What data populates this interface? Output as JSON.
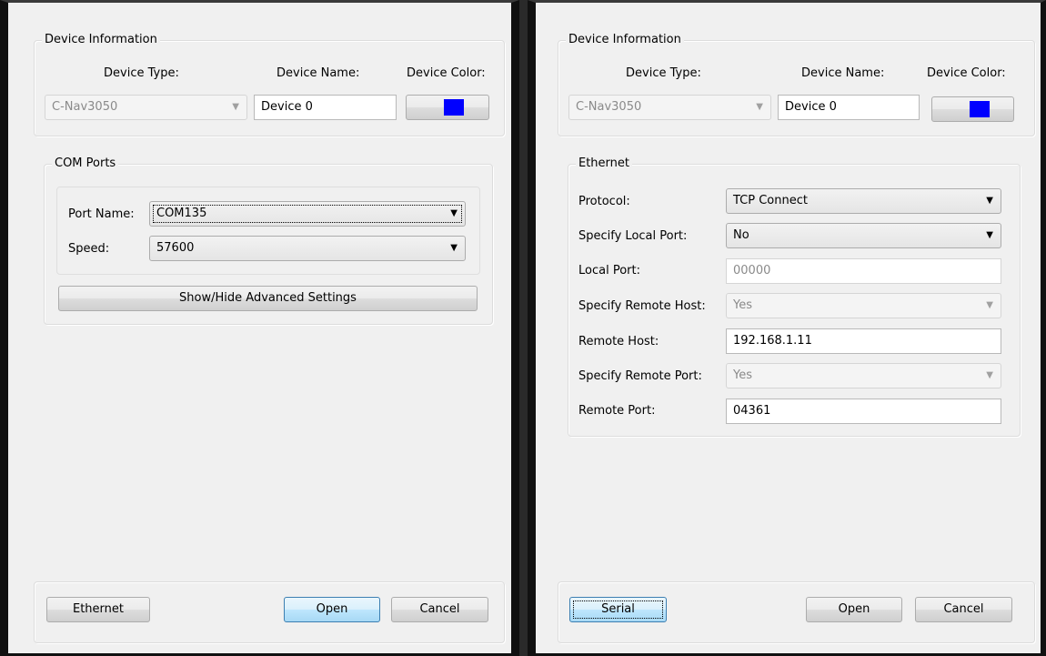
{
  "left_dialog": {
    "device_info": {
      "title": "Device Information",
      "type_label": "Device Type:",
      "name_label": "Device Name:",
      "color_label": "Device Color:",
      "type_value": "C-Nav3050",
      "name_value": "Device 0",
      "color": "#0000ff"
    },
    "com_ports": {
      "title": "COM Ports",
      "port_label": "Port Name:",
      "port_value": "COM135",
      "speed_label": "Speed:",
      "speed_value": "57600",
      "advanced_button": "Show/Hide Advanced Settings"
    },
    "footer": {
      "switch_button": "Ethernet",
      "open_button": "Open",
      "cancel_button": "Cancel"
    }
  },
  "right_dialog": {
    "device_info": {
      "title": "Device Information",
      "type_label": "Device Type:",
      "name_label": "Device Name:",
      "color_label": "Device Color:",
      "type_value": "C-Nav3050",
      "name_value": "Device 0",
      "color": "#0000ff"
    },
    "ethernet": {
      "title": "Ethernet",
      "protocol_label": "Protocol:",
      "protocol_value": "TCP Connect",
      "specify_local_port_label": "Specify Local Port:",
      "specify_local_port_value": "No",
      "local_port_label": "Local Port:",
      "local_port_value": "00000",
      "specify_remote_host_label": "Specify Remote Host:",
      "specify_remote_host_value": "Yes",
      "remote_host_label": "Remote Host:",
      "remote_host_value": "192.168.1.11",
      "specify_remote_port_label": "Specify Remote Port:",
      "specify_remote_port_value": "Yes",
      "remote_port_label": "Remote Port:",
      "remote_port_value": "04361"
    },
    "footer": {
      "switch_button": "Serial",
      "open_button": "Open",
      "cancel_button": "Cancel"
    }
  },
  "icons": {
    "dropdown_arrow": "chevron-down-icon"
  }
}
